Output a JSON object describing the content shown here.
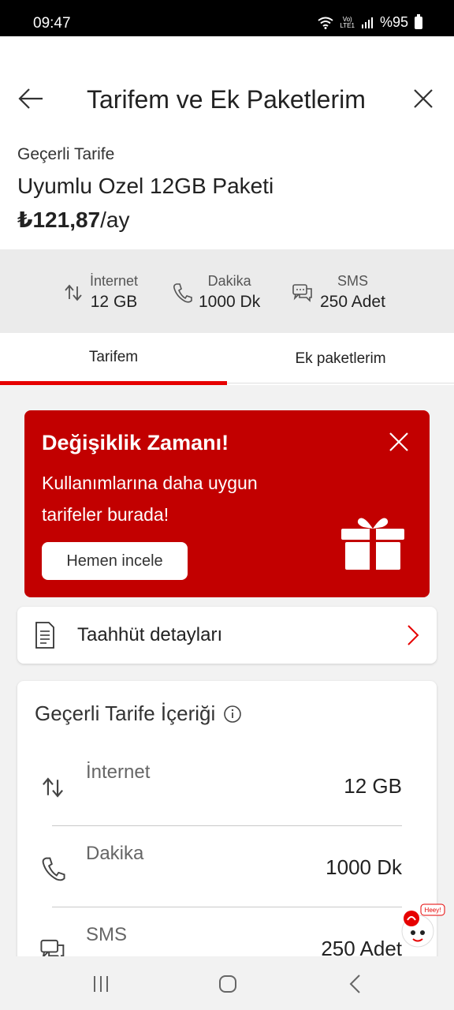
{
  "status": {
    "time": "09:47",
    "network_top": "Vo)",
    "network_bottom": "LTE1",
    "battery": "%95"
  },
  "header": {
    "title": "Tarifem ve Ek Paketlerim",
    "tariff_label": "Geçerli Tarife",
    "tariff_name": "Uyumlu Ozel 12GB Paketi",
    "price": "₺121,87",
    "price_unit": "/ay"
  },
  "summary": [
    {
      "label": "İnternet",
      "value": "12 GB",
      "icon": "internet-arrows-icon"
    },
    {
      "label": "Dakika",
      "value": "1000 Dk",
      "icon": "phone-icon"
    },
    {
      "label": "SMS",
      "value": "250 Adet",
      "icon": "chat-bubbles-icon"
    }
  ],
  "tabs": [
    {
      "label": "Tarifem",
      "active": true
    },
    {
      "label": "Ek paketlerim",
      "active": false
    }
  ],
  "promo": {
    "title": "Değişiklik Zamanı!",
    "text": "Kullanımlarına daha uygun tarifeler burada!",
    "button": "Hemen incele",
    "icon": "gift-icon"
  },
  "commitment": {
    "label": "Taahhüt detayları"
  },
  "content": {
    "title": "Geçerli Tarife İçeriği",
    "rows": [
      {
        "label": "İnternet",
        "value": "12 GB"
      },
      {
        "label": "Dakika",
        "value": "1000 Dk"
      },
      {
        "label": "SMS",
        "value": "250 Adet"
      }
    ]
  },
  "mascot": {
    "text": "Heey!"
  },
  "colors": {
    "brand_red": "#e60000",
    "promo_bg": "#c20000"
  }
}
